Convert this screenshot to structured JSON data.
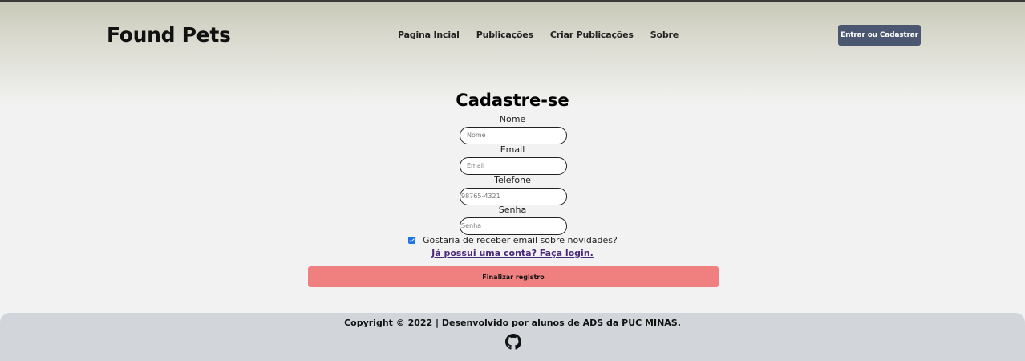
{
  "brand": "Found Pets",
  "nav": {
    "items": [
      "Pagina Incial",
      "Publicações",
      "Criar Publicações",
      "Sobre"
    ]
  },
  "header": {
    "login_button": "Entrar ou Cadastrar"
  },
  "form": {
    "title": "Cadastre-se",
    "name_label": "Nome",
    "name_placeholder": "Nome",
    "email_label": "Email",
    "email_placeholder": "Email",
    "phone_label": "Telefone",
    "phone_placeholder": "98765-4321",
    "password_label": "Senha",
    "password_placeholder": "Senha",
    "newsletter_label": "Gostaria de receber email sobre novidades?",
    "newsletter_checked": true,
    "login_link": "Já possui uma conta? Faça login.",
    "submit": "Finalizar registro"
  },
  "footer": {
    "copyright": "Copyright © 2022 | Desenvolvido por alunos de ADS da PUC MINAS.",
    "icon": "github-icon"
  },
  "colors": {
    "login_button_bg": "#4b5670",
    "submit_bg": "#f08080",
    "footer_bg": "#d2d6da",
    "link": "#4b2a7a"
  }
}
